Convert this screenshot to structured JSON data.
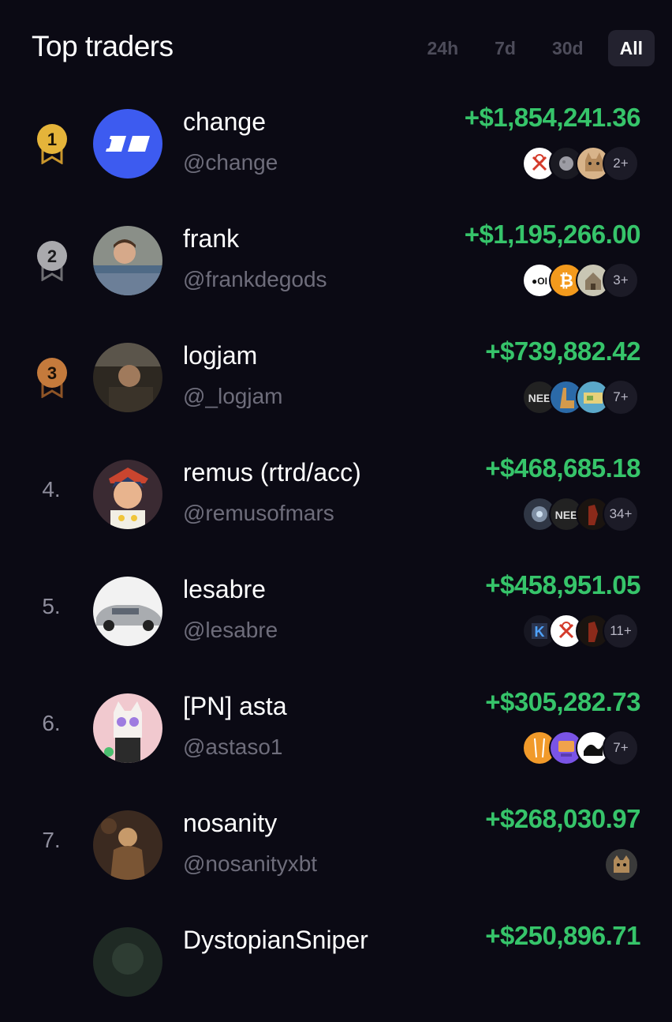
{
  "header": {
    "title": "Top traders",
    "tabs": [
      {
        "label": "24h",
        "active": false
      },
      {
        "label": "7d",
        "active": false
      },
      {
        "label": "30d",
        "active": false
      },
      {
        "label": "All",
        "active": true
      }
    ]
  },
  "colors": {
    "background": "#0b0a14",
    "profit": "#36c46a",
    "active_tab": "#23222f",
    "gold": "#e5b43a",
    "silver": "#a9a9ad",
    "bronze": "#c47a3c"
  },
  "traders": [
    {
      "rank": "1",
      "name": "change",
      "handle": "@change",
      "pnl": "+$1,854,241.36",
      "more": "2+",
      "medal": "gold",
      "tokens": [
        "red-white-cross-token",
        "grey-moon-token",
        "cat-token"
      ]
    },
    {
      "rank": "2",
      "name": "frank",
      "handle": "@frankdegods",
      "pnl": "+$1,195,266.00",
      "more": "3+",
      "medal": "silver",
      "tokens": [
        "oil-token",
        "bitcoin-token",
        "house-token"
      ]
    },
    {
      "rank": "3",
      "name": "logjam",
      "handle": "@_logjam",
      "pnl": "+$739,882.42",
      "more": "7+",
      "medal": "bronze",
      "tokens": [
        "nee-token",
        "llama-token",
        "map-token"
      ]
    },
    {
      "rank": "4.",
      "name": "remus (rtrd/acc)",
      "handle": "@remusofmars",
      "pnl": "+$468,685.18",
      "more": "34+",
      "tokens": [
        "robot-token",
        "nee-token",
        "dark-figure-token"
      ]
    },
    {
      "rank": "5.",
      "name": "lesabre",
      "handle": "@lesabre",
      "pnl": "+$458,951.05",
      "more": "11+",
      "tokens": [
        "k-token",
        "red-white-cross-token",
        "dark-figure-token"
      ]
    },
    {
      "rank": "6.",
      "name": "[PN] asta",
      "handle": "@astaso1",
      "pnl": "+$305,282.73",
      "more": "7+",
      "tokens": [
        "orange-token",
        "computer-token",
        "wave-token"
      ]
    },
    {
      "rank": "7.",
      "name": "nosanity",
      "handle": "@nosanityxbt",
      "pnl": "+$268,030.97",
      "more": "",
      "tokens": [
        "cougar-token"
      ]
    },
    {
      "rank": "",
      "name": "DystopianSniper",
      "handle": "",
      "pnl": "+$250,896.71",
      "more": "",
      "tokens": []
    }
  ]
}
